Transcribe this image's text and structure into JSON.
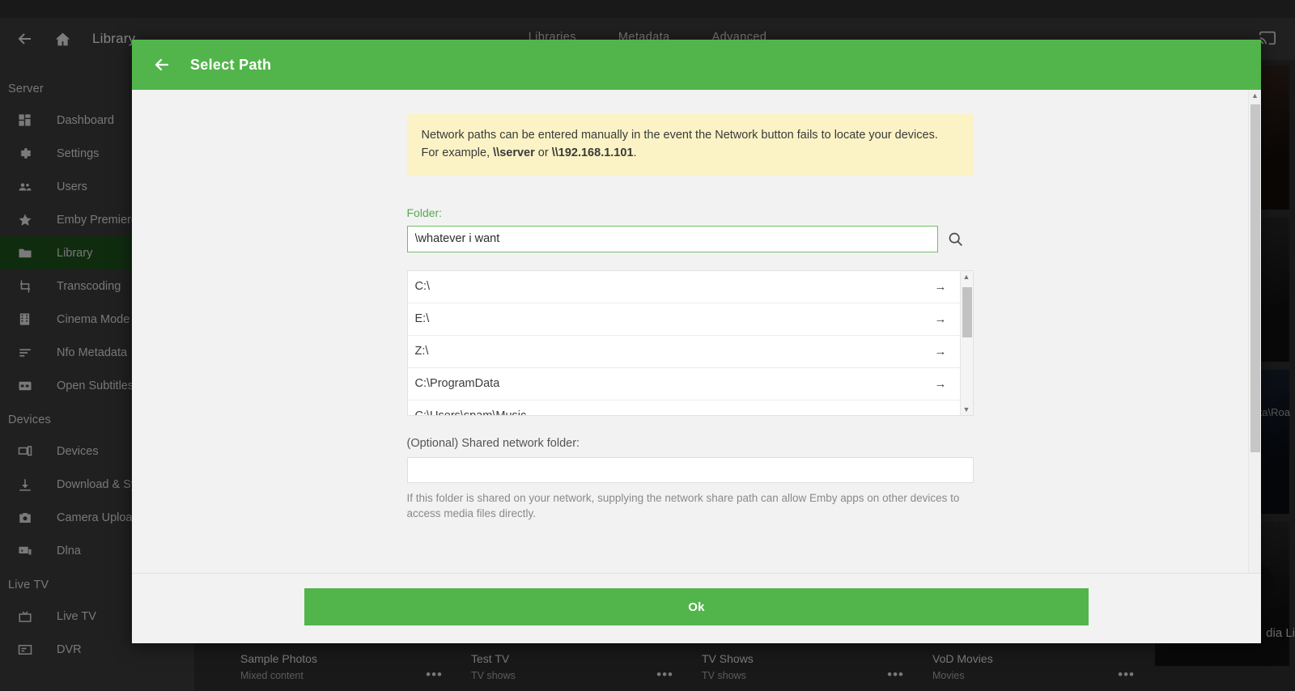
{
  "topbar": {
    "back_icon": "arrow-left-icon",
    "home_icon": "home-icon",
    "title": "Library",
    "cast_icon": "cast-icon",
    "tabs": [
      "Libraries",
      "Metadata",
      "Advanced"
    ]
  },
  "sidebar": {
    "sections": [
      {
        "heading": "Server",
        "items": [
          {
            "label": "Dashboard",
            "icon": "dashboard-icon",
            "active": false
          },
          {
            "label": "Settings",
            "icon": "gear-icon",
            "active": false
          },
          {
            "label": "Users",
            "icon": "users-icon",
            "active": false
          },
          {
            "label": "Emby Premiere",
            "icon": "star-icon",
            "active": false
          },
          {
            "label": "Library",
            "icon": "folder-icon",
            "active": true
          },
          {
            "label": "Transcoding",
            "icon": "transcode-icon",
            "active": false
          },
          {
            "label": "Cinema Mode",
            "icon": "film-icon",
            "active": false
          },
          {
            "label": "Nfo Metadata",
            "icon": "lines-icon",
            "active": false
          },
          {
            "label": "Open Subtitles",
            "icon": "subtitles-icon",
            "active": false
          }
        ]
      },
      {
        "heading": "Devices",
        "items": [
          {
            "label": "Devices",
            "icon": "devices-icon",
            "active": false
          },
          {
            "label": "Download & Sync",
            "icon": "download-icon",
            "active": false
          },
          {
            "label": "Camera Upload",
            "icon": "camera-icon",
            "active": false
          },
          {
            "label": "Dlna",
            "icon": "dlna-icon",
            "active": false
          }
        ]
      },
      {
        "heading": "Live TV",
        "items": [
          {
            "label": "Live TV",
            "icon": "livetv-icon",
            "active": false
          },
          {
            "label": "DVR",
            "icon": "dvr-icon",
            "active": false
          }
        ]
      }
    ]
  },
  "background": {
    "path_text": "ata\\Roa",
    "fab_icon": "plus-icon",
    "fab_label": "dia Li",
    "cards": [
      {
        "title": "Sample Photos",
        "subtitle": "Mixed content",
        "menu": "•••"
      },
      {
        "title": "Test TV",
        "subtitle": "TV shows",
        "menu": "•••"
      },
      {
        "title": "TV Shows",
        "subtitle": "TV shows",
        "menu": "•••"
      },
      {
        "title": "VoD Movies",
        "subtitle": "Movies",
        "menu": "•••"
      }
    ]
  },
  "dialog": {
    "back_icon": "arrow-left-icon",
    "title": "Select Path",
    "notice": {
      "text_before": "Network paths can be entered manually in the event the Network button fails to locate your devices. For example, ",
      "bold_1": "\\\\server",
      "text_middle": " or ",
      "bold_2": "\\\\192.168.1.101",
      "text_after": "."
    },
    "folder": {
      "label": "Folder:",
      "value": "\\whatever i want",
      "placeholder": "",
      "search_icon": "search-icon"
    },
    "folder_list": [
      {
        "path": "C:\\",
        "arrow": "arrow-right-icon"
      },
      {
        "path": "E:\\",
        "arrow": "arrow-right-icon"
      },
      {
        "path": "Z:\\",
        "arrow": "arrow-right-icon"
      },
      {
        "path": "C:\\ProgramData",
        "arrow": "arrow-right-icon"
      },
      {
        "path": "C:\\Users\\spam\\Music",
        "arrow": "arrow-right-icon"
      }
    ],
    "shared": {
      "label": "(Optional) Shared network folder:",
      "value": "",
      "placeholder": "",
      "help": "If this folder is shared on your network, supplying the network share path can allow Emby apps on other devices to access media files directly."
    },
    "ok_label": "Ok"
  },
  "colors": {
    "accent_green": "#52b54b",
    "sidebar_active": "#1d4d1b",
    "notice_yellow": "#fbf3c5",
    "dialog_bg": "#f2f2f2"
  }
}
